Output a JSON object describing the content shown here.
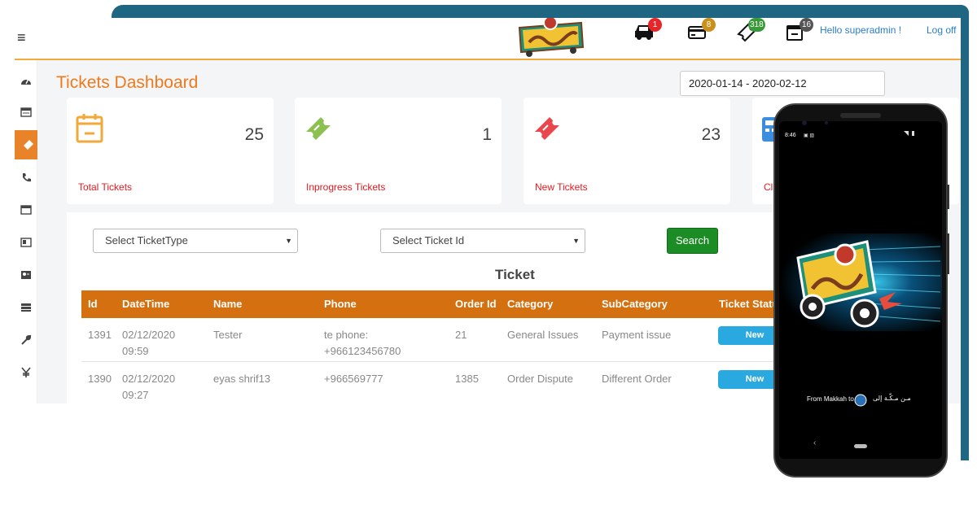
{
  "header": {
    "hello": "Hello superadmin !",
    "logoff": "Log off",
    "notifications": [
      {
        "icon": "car-icon",
        "count": "1",
        "color": "#e8262a"
      },
      {
        "icon": "credit-card-icon",
        "count": "8",
        "color": "#c9901c"
      },
      {
        "icon": "ticket-icon",
        "count": "318",
        "color": "#3a9a3a"
      },
      {
        "icon": "calendar-minus-icon",
        "count": "16",
        "color": "#555555"
      }
    ]
  },
  "page": {
    "title": "Tickets Dashboard",
    "date_range": "2020-01-14 - 2020-02-12"
  },
  "cards": [
    {
      "label": "Total Tickets",
      "count": "25",
      "icon": "calendar-icon",
      "color": "#f2a93b"
    },
    {
      "label": "Inprogress Tickets",
      "count": "1",
      "icon": "ticket-icon",
      "color": "#8cc152"
    },
    {
      "label": "New Tickets",
      "count": "23",
      "icon": "ticket-icon",
      "color": "#e9464d"
    },
    {
      "label": "Cl",
      "count": "",
      "icon": "calculator-icon",
      "color": "#3b8de0"
    }
  ],
  "filters": {
    "ticket_type": "Select TicketType",
    "ticket_id": "Select Ticket Id",
    "search_label": "Search"
  },
  "table": {
    "title": "Ticket",
    "columns": [
      "Id",
      "DateTime",
      "Name",
      "Phone",
      "Order Id",
      "Category",
      "SubCategory",
      "Ticket Status"
    ],
    "rows": [
      {
        "id": "1391",
        "date": "02/12/2020",
        "time": "09:59",
        "name": "Tester",
        "phone": "te phone:",
        "phone2": "+966123456780",
        "order_id": "21",
        "category": "General Issues",
        "subcategory": "Payment issue",
        "status": "New"
      },
      {
        "id": "1390",
        "date": "02/12/2020",
        "time": "09:27",
        "name": "eyas shrif13",
        "phone": "+966569777",
        "phone2": "",
        "order_id": "1385",
        "category": "Order Dispute",
        "subcategory": "Different Order",
        "status": "New"
      }
    ]
  },
  "phone": {
    "time": "8:46",
    "from_text": "From Makkah to",
    "arabic_text": "مـن مـكّـة إلى"
  },
  "colors": {
    "accent": "#ee7a1b",
    "table_header": "#d4700f",
    "frame": "#1e6682"
  }
}
